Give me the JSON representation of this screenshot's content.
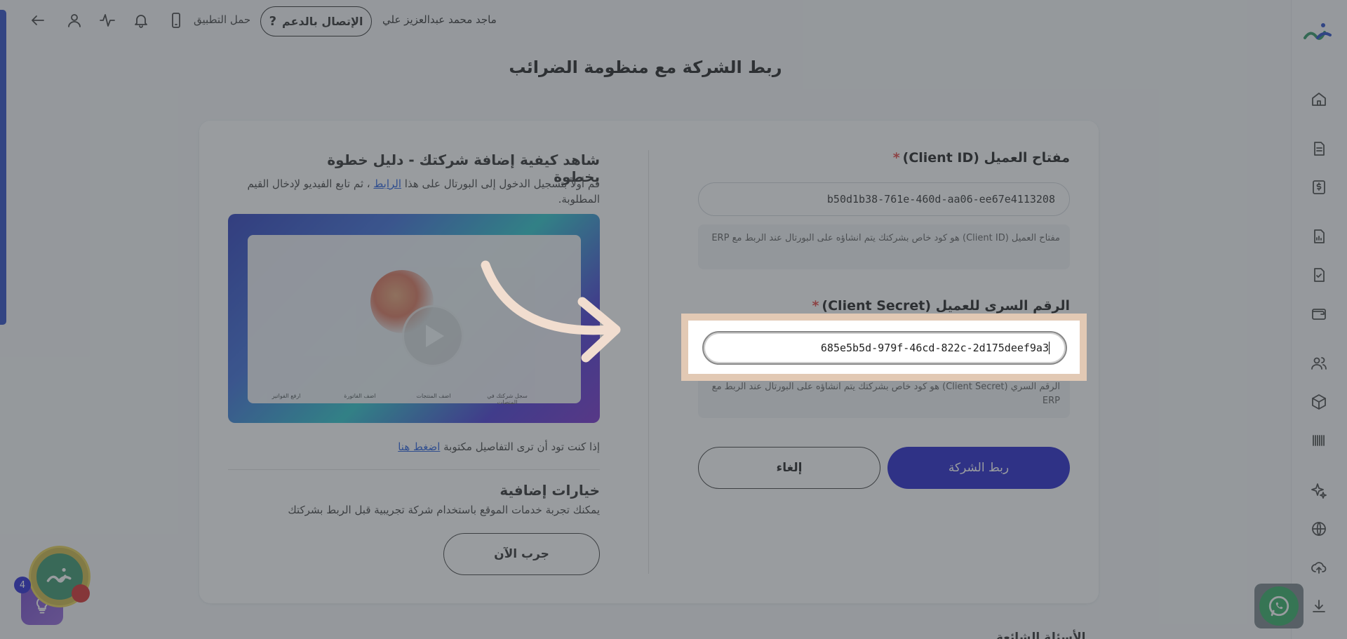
{
  "topbar": {
    "user_name": "ماجد محمد عبدالعزيز علي",
    "support_label": "الإتصال بالدعم",
    "support_icon": "?",
    "app_label": "حمل التطبيق"
  },
  "page": {
    "title": "ربط الشركة مع منظومة الضرائب"
  },
  "form": {
    "client_id_label": "مفتاح العميل (Client ID)",
    "client_id_value": "b50d1b38-761e-460d-aa06-ee67e4113208",
    "client_id_hint": "مفتاح العميل (Client ID) هو كود خاص بشركتك يتم انشاؤه على البورتال عند الربط مع ERP",
    "client_secret_label": "الرقم السرى للعميل (Client Secret)",
    "client_secret_value": "685e5b5d-979f-46cd-822c-2d175deef9a3",
    "client_secret_hint": "الرقم السري (Client Secret) هو كود خاص بشركتك يتم انشاؤه على البورتال عند الربط مع ERP",
    "required_mark": "*",
    "submit_label": "ربط الشركة",
    "cancel_label": "إلغاء"
  },
  "guide": {
    "title": "شاهد كيفية إضافة شركتك - دليل خطوة بخطوة",
    "desc_before": "قم أولاً بتسجيل الدخول إلى البورتال على هذا ",
    "desc_link": "الرابط",
    "desc_after": " ، ثم تابع الفيديو لإدخال القيم المطلوبة.",
    "details_text": "إذا كنت تود أن ترى التفاصيل مكتوبة ",
    "details_link": "اضغط هنا",
    "video_items": [
      "سجل شركتك في المنصات",
      "اضف المنتجات",
      "اضف الفاتورة",
      "ارفع الفواتير"
    ]
  },
  "extra": {
    "title": "خيارات إضافية",
    "desc": "يمكنك تجربة خدمات الموقع باستخدام شركة تجريبية قبل الربط بشركتك",
    "try_label": "جرب الآن"
  },
  "bottom": {
    "partial_heading": "الأسئلة الشائعة"
  },
  "widgets": {
    "notification_count": "4"
  },
  "colors": {
    "primary": "#1614c8",
    "accent_bar": "#1e3fc2",
    "required": "#e53935",
    "highlight_border": "#e2c9b4",
    "whatsapp": "#25a85a"
  },
  "icons": {
    "sidebar": [
      "home-icon",
      "document-icon",
      "invoice-dollar-icon",
      "report-icon",
      "checklist-icon",
      "wallet-icon",
      "users-icon",
      "box-icon",
      "barcode-icon",
      "sparkle-icon",
      "globe-icon",
      "upload-icon",
      "download-icon"
    ],
    "topbar": [
      "back-arrow-icon",
      "user-icon",
      "activity-icon",
      "bell-icon",
      "phone-icon"
    ]
  }
}
